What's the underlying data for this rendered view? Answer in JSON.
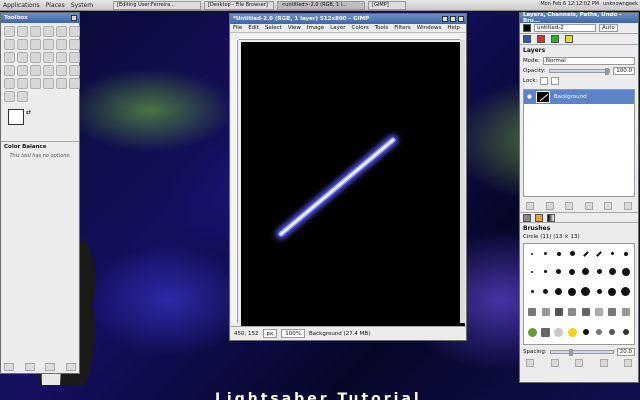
{
  "panel": {
    "menus": [
      "Applications",
      "Places",
      "System"
    ],
    "tasks": [
      "[Editing User:Ferreira...",
      "[Desktop - File Browser]",
      "<untitled>-2.0 (RGB, 1 l...",
      "[GIMP]"
    ],
    "clock": "Mon Feb  6  12:12:02 PM",
    "user": "unknowngeek"
  },
  "toolbox": {
    "title": "Toolbox",
    "section_title": "Color Balance",
    "note": "This tool has no options."
  },
  "image_window": {
    "title": "*Untitled-2.0 (RGB, 1 layer) 512x800 – GIMP",
    "menus": [
      "File",
      "Edit",
      "Select",
      "View",
      "Image",
      "Layer",
      "Colors",
      "Tools",
      "Filters",
      "Windows",
      "Help"
    ],
    "status": {
      "coords": "450, 152",
      "unit": "px",
      "zoom": "100%",
      "info": "Background (27.4 MB)"
    }
  },
  "layers_dock": {
    "title": "Layers, Channels, Paths, Undo - Bru...",
    "image_name": "untitled-2",
    "auto_label": "Auto",
    "section_title": "Layers",
    "mode_label": "Mode:",
    "mode_value": "Normal",
    "opacity_label": "Opacity:",
    "opacity_value": "100.0",
    "lock_label": "Lock:",
    "layer_name": "Background"
  },
  "brushes": {
    "title": "Brushes",
    "current": "Circle (11) (13 × 13)",
    "spacing_label": "Spacing:",
    "spacing_value": "20.0"
  },
  "desktop": {
    "big_text": "Lightsaber  Tutorial"
  },
  "colors": {
    "accent": "#3f66a8",
    "saber_glow": "#6e7bff",
    "layer_selected": "#5a85c8"
  }
}
